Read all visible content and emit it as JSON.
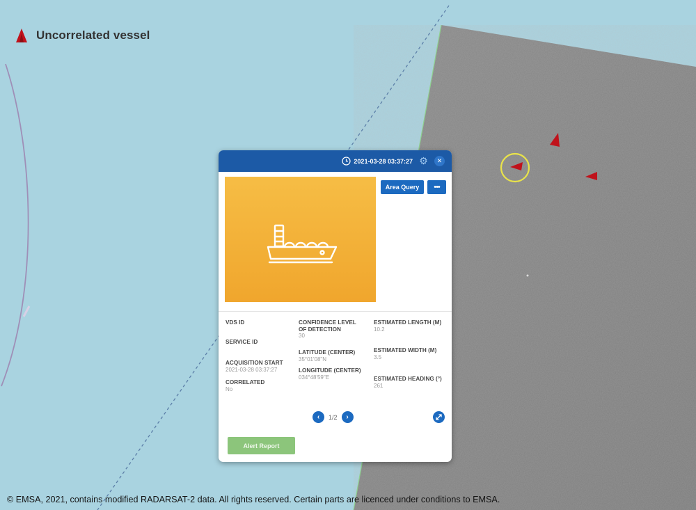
{
  "legend": {
    "icon": "red-triangle-icon",
    "label": "Uncorrelated vessel"
  },
  "map": {
    "icons": [
      "vessel-marker-icon",
      "vessel-marker-icon",
      "vessel-marker-icon",
      "selection-ring-icon"
    ]
  },
  "popup": {
    "timestamp": "2021-03-28 03:37:27",
    "thumbnail_icon": "ship-icon",
    "buttons": {
      "area_query": "Area Query",
      "more": "•••"
    },
    "fields": {
      "vds_id": {
        "label": "VDS ID",
        "value": ""
      },
      "service_id": {
        "label": "SERVICE ID",
        "value": ""
      },
      "acquisition_start": {
        "label": "ACQUISITION START",
        "value": "2021-03-28 03:37:27"
      },
      "correlated": {
        "label": "CORRELATED",
        "value": "No"
      },
      "confidence": {
        "label": "CONFIDENCE LEVEL OF DETECTION",
        "value": "30"
      },
      "latitude": {
        "label": "LATITUDE (CENTER)",
        "value": "35°01'08\"N"
      },
      "longitude": {
        "label": "LONGITUDE (CENTER)",
        "value": "034°48'59\"E"
      },
      "length": {
        "label": "ESTIMATED LENGTH (M)",
        "value": "10.2"
      },
      "width": {
        "label": "ESTIMATED WIDTH (M)",
        "value": "3.5"
      },
      "heading": {
        "label": "ESTIMATED HEADING (°)",
        "value": "261"
      }
    },
    "pager": {
      "text": "1/2",
      "prev": "‹",
      "next": "›"
    },
    "alert_button": "Alert Report"
  },
  "colors": {
    "header": "#1c5aa6",
    "button": "#1c6ac0",
    "alert": "#8cc57b",
    "thumb": "#f2ab33",
    "sea": "#a9d3e0",
    "vessel": "#c0121b"
  },
  "copyright": "© EMSA, 2021, contains modified RADARSAT-2 data. All rights reserved. Certain parts are licenced under conditions to EMSA."
}
